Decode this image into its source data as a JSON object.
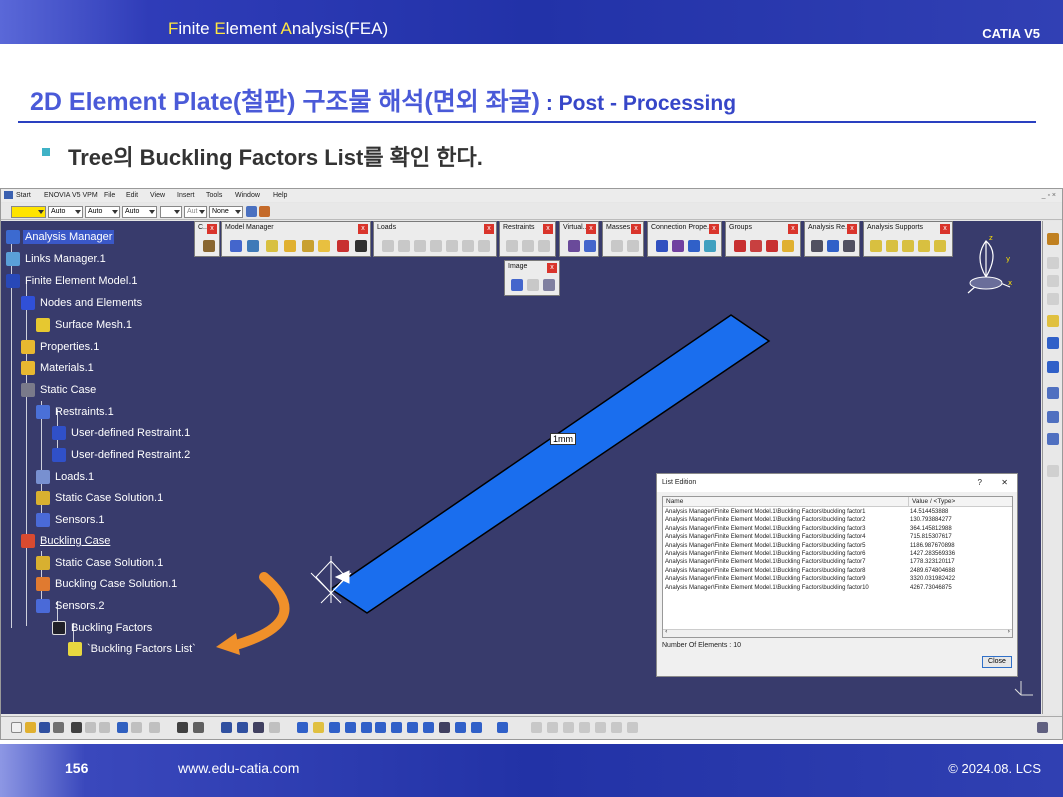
{
  "header": {
    "t1": "F",
    "t2": "inite ",
    "t3": "E",
    "t4": "lement ",
    "t5": "A",
    "t6": "nalysis(FEA)",
    "product": "CATIA V5"
  },
  "slide": {
    "title_main": "2D Element Plate(철판) 구조물 해석(면외 좌굴)",
    "title_sub": " : Post - Processing",
    "bullet_text": "Tree의 Buckling Factors List를 확인 한다."
  },
  "menubar": {
    "items": [
      "Start",
      "ENOVIA V5 VPM",
      "File",
      "Edit",
      "View",
      "Insert",
      "Tools",
      "Window",
      "Help"
    ]
  },
  "stdbar": {
    "combo1": "Auto",
    "combo2": "Auto",
    "combo3": "Auto",
    "combo4": "Aut",
    "combo5": "None"
  },
  "toolbars": [
    {
      "title": "C..."
    },
    {
      "title": "Model Manager"
    },
    {
      "title": "Loads"
    },
    {
      "title": "Restraints"
    },
    {
      "title": "Virtual..."
    },
    {
      "title": "Masses"
    },
    {
      "title": "Connection Prope..."
    },
    {
      "title": "Groups"
    },
    {
      "title": "Analysis Re..."
    },
    {
      "title": "Analysis Supports"
    },
    {
      "title": "Image"
    }
  ],
  "tree": [
    {
      "label": "Analysis Manager"
    },
    {
      "label": "Links Manager.1"
    },
    {
      "label": "Finite Element Model.1"
    },
    {
      "label": "Nodes and Elements"
    },
    {
      "label": "Surface Mesh.1"
    },
    {
      "label": "Properties.1"
    },
    {
      "label": "Materials.1"
    },
    {
      "label": "Static Case"
    },
    {
      "label": "Restraints.1"
    },
    {
      "label": "User-defined Restraint.1"
    },
    {
      "label": "User-defined Restraint.2"
    },
    {
      "label": "Loads.1"
    },
    {
      "label": "Static Case Solution.1"
    },
    {
      "label": "Sensors.1"
    },
    {
      "label": "Buckling Case"
    },
    {
      "label": "Static Case Solution.1"
    },
    {
      "label": "Buckling Case Solution.1"
    },
    {
      "label": "Sensors.2"
    },
    {
      "label": "Buckling Factors"
    },
    {
      "label": "`Buckling Factors List`"
    }
  ],
  "viewport": {
    "dimension_label": "1mm",
    "plate_color": "#1a6eee"
  },
  "dialog": {
    "title": "List Edition",
    "help": "?",
    "close_x": "✕",
    "col_name": "Name",
    "col_value": "Value / <Type>",
    "rows": [
      {
        "name": "Analysis Manager\\Finite Element Model.1\\Buckling Factors\\buckling factor1",
        "value": "14.514453888"
      },
      {
        "name": "Analysis Manager\\Finite Element Model.1\\Buckling Factors\\buckling factor2",
        "value": "130.793884277"
      },
      {
        "name": "Analysis Manager\\Finite Element Model.1\\Buckling Factors\\buckling factor3",
        "value": "364.145812988"
      },
      {
        "name": "Analysis Manager\\Finite Element Model.1\\Buckling Factors\\buckling factor4",
        "value": "715.815307617"
      },
      {
        "name": "Analysis Manager\\Finite Element Model.1\\Buckling Factors\\buckling factor5",
        "value": "1186.987670898"
      },
      {
        "name": "Analysis Manager\\Finite Element Model.1\\Buckling Factors\\buckling factor6",
        "value": "1427.283569336"
      },
      {
        "name": "Analysis Manager\\Finite Element Model.1\\Buckling Factors\\buckling factor7",
        "value": "1778.323120117"
      },
      {
        "name": "Analysis Manager\\Finite Element Model.1\\Buckling Factors\\buckling factor8",
        "value": "2489.674804688"
      },
      {
        "name": "Analysis Manager\\Finite Element Model.1\\Buckling Factors\\buckling factor9",
        "value": "3320.031982422"
      },
      {
        "name": "Analysis Manager\\Finite Element Model.1\\Buckling Factors\\buckling factor10",
        "value": "4267.73046875"
      }
    ],
    "footer": "Number Of Elements : 10",
    "close_button": "Close"
  },
  "footer": {
    "page": "156",
    "url": "www.edu-catia.com",
    "copyright": "© 2024.08. LCS"
  }
}
